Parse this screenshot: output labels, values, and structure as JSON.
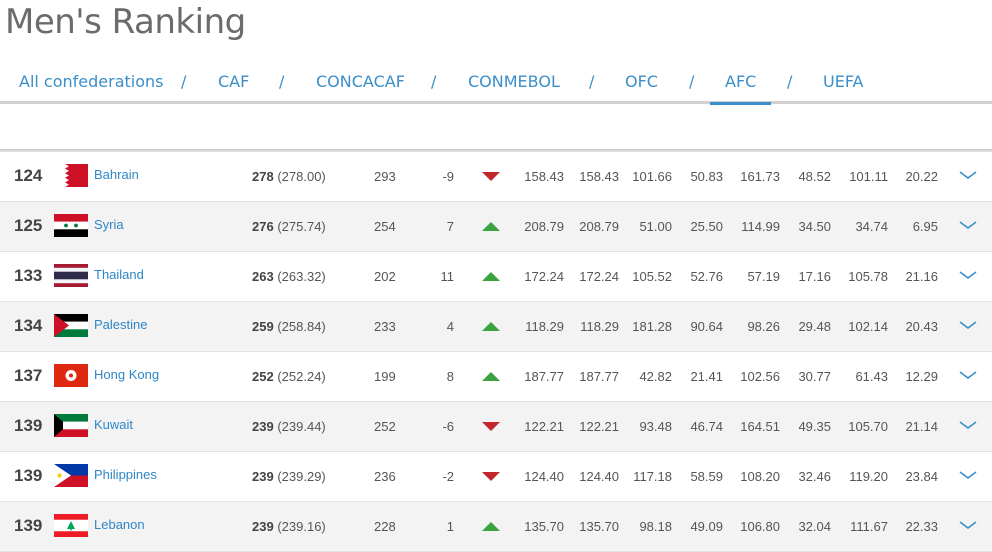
{
  "page": {
    "title": "Men's Ranking"
  },
  "tabs": [
    {
      "label": "All confederations"
    },
    {
      "label": "CAF"
    },
    {
      "label": "CONCACAF"
    },
    {
      "label": "CONMEBOL"
    },
    {
      "label": "OFC"
    },
    {
      "label": "AFC",
      "active": true
    },
    {
      "label": "UEFA"
    }
  ],
  "tab_separator": "/",
  "colors": {
    "accent": "#3a8ec9",
    "up": "#3aa23e",
    "down": "#c0282e"
  },
  "rows": [
    {
      "rank": "124",
      "country": "Bahrain",
      "flag": "flag-bahrain",
      "points": "278",
      "points_exact": "(278.00)",
      "prev_points": "293",
      "diff": "-9",
      "trend": "down",
      "vals": [
        "158.43",
        "158.43",
        "101.66",
        "50.83",
        "161.73",
        "48.52",
        "101.11",
        "20.22"
      ]
    },
    {
      "rank": "125",
      "country": "Syria",
      "flag": "flag-syria",
      "points": "276",
      "points_exact": "(275.74)",
      "prev_points": "254",
      "diff": "7",
      "trend": "up",
      "vals": [
        "208.79",
        "208.79",
        "51.00",
        "25.50",
        "114.99",
        "34.50",
        "34.74",
        "6.95"
      ]
    },
    {
      "rank": "133",
      "country": "Thailand",
      "flag": "flag-thailand",
      "points": "263",
      "points_exact": "(263.32)",
      "prev_points": "202",
      "diff": "11",
      "trend": "up",
      "vals": [
        "172.24",
        "172.24",
        "105.52",
        "52.76",
        "57.19",
        "17.16",
        "105.78",
        "21.16"
      ]
    },
    {
      "rank": "134",
      "country": "Palestine",
      "flag": "flag-palestine",
      "points": "259",
      "points_exact": "(258.84)",
      "prev_points": "233",
      "diff": "4",
      "trend": "up",
      "vals": [
        "118.29",
        "118.29",
        "181.28",
        "90.64",
        "98.26",
        "29.48",
        "102.14",
        "20.43"
      ]
    },
    {
      "rank": "137",
      "country": "Hong Kong",
      "flag": "flag-hong-kong",
      "points": "252",
      "points_exact": "(252.24)",
      "prev_points": "199",
      "diff": "8",
      "trend": "up",
      "vals": [
        "187.77",
        "187.77",
        "42.82",
        "21.41",
        "102.56",
        "30.77",
        "61.43",
        "12.29"
      ]
    },
    {
      "rank": "139",
      "country": "Kuwait",
      "flag": "flag-kuwait",
      "points": "239",
      "points_exact": "(239.44)",
      "prev_points": "252",
      "diff": "-6",
      "trend": "down",
      "vals": [
        "122.21",
        "122.21",
        "93.48",
        "46.74",
        "164.51",
        "49.35",
        "105.70",
        "21.14"
      ]
    },
    {
      "rank": "139",
      "country": "Philippines",
      "flag": "flag-philippines",
      "points": "239",
      "points_exact": "(239.29)",
      "prev_points": "236",
      "diff": "-2",
      "trend": "down",
      "vals": [
        "124.40",
        "124.40",
        "117.18",
        "58.59",
        "108.20",
        "32.46",
        "119.20",
        "23.84"
      ]
    },
    {
      "rank": "139",
      "country": "Lebanon",
      "flag": "flag-lebanon",
      "points": "239",
      "points_exact": "(239.16)",
      "prev_points": "228",
      "diff": "1",
      "trend": "up",
      "vals": [
        "135.70",
        "135.70",
        "98.18",
        "49.09",
        "106.80",
        "32.04",
        "111.67",
        "22.33"
      ]
    }
  ]
}
